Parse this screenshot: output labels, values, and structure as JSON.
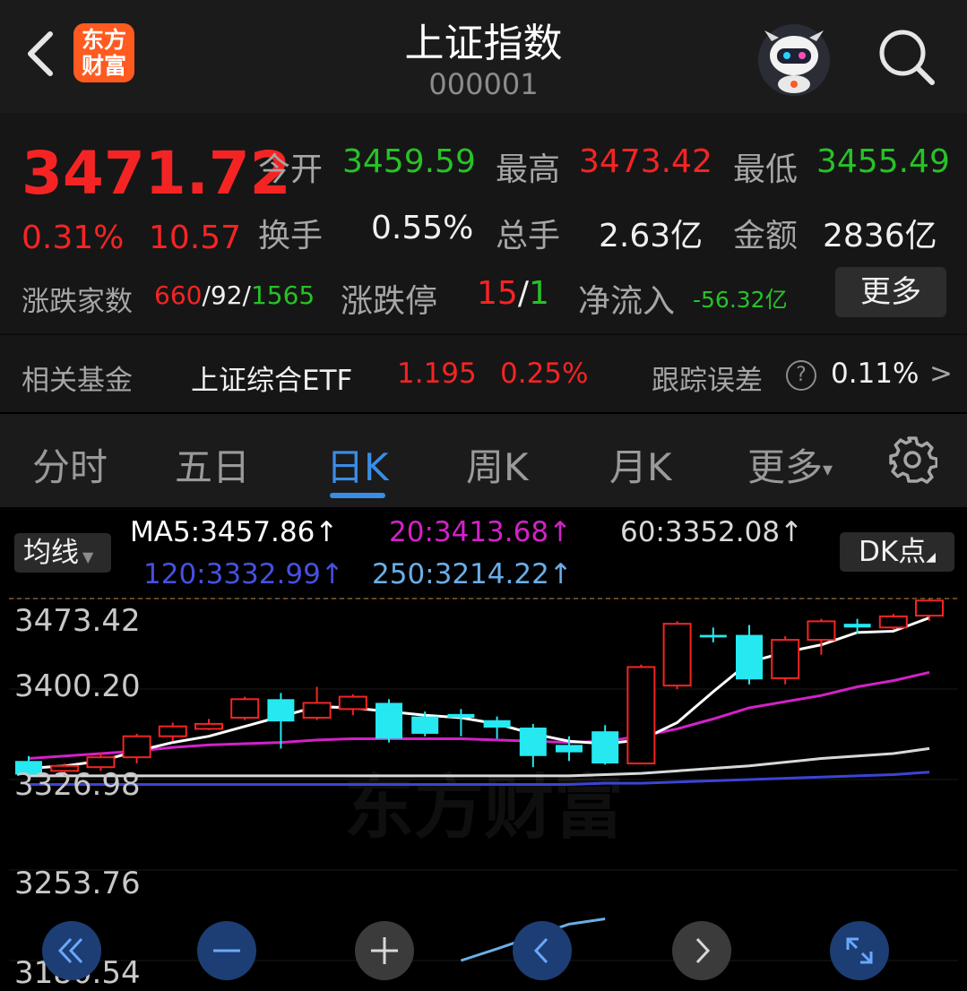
{
  "header": {
    "title": "上证指数",
    "code": "000001",
    "logo_line1": "东方",
    "logo_line2": "财富"
  },
  "quote": {
    "price": "3471.72",
    "change_pct": "0.31%",
    "change": "10.57",
    "open_label": "今开",
    "open": "3459.59",
    "high_label": "最高",
    "high": "3473.42",
    "low_label": "最低",
    "low": "3455.49",
    "turnover_label": "换手",
    "turnover": "0.55%",
    "volume_label": "总手",
    "volume": "2.63亿",
    "amount_label": "金额",
    "amount": "2836亿",
    "breadth_label": "涨跌家数",
    "breadth_up": "660",
    "breadth_flat": "92",
    "breadth_down": "1565",
    "sep": "/",
    "limit_label": "涨跌停",
    "limit_up": "15",
    "limit_down": "1",
    "netflow_label": "净流入",
    "netflow": "-56.32亿",
    "more": "更多"
  },
  "fund": {
    "label": "相关基金",
    "name": "上证综合ETF",
    "price": "1.195",
    "pct": "0.25%",
    "error_label": "跟踪误差",
    "error_value": "0.11%",
    "arrow": ">"
  },
  "tabs": [
    {
      "label": "分时"
    },
    {
      "label": "五日"
    },
    {
      "label": "日K"
    },
    {
      "label": "周K"
    },
    {
      "label": "月K"
    },
    {
      "label": "更多"
    }
  ],
  "indicator": {
    "selector": "均线",
    "dk": "DK点",
    "ma5": "MA5:3457.86↑",
    "ma20": "20:3413.68↑",
    "ma60": "60:3352.08↑",
    "ma120": "120:3332.99↑",
    "ma250": "250:3214.22↑"
  },
  "colors": {
    "up": "#f52424",
    "down": "#25e8f0",
    "ma5": "#ffffff",
    "ma20": "#d321c8",
    "ma60": "#d8d8d8",
    "ma120": "#3b44d6",
    "ma250": "#6aaee8"
  },
  "chart_data": {
    "type": "candlestick",
    "y_ticks": [
      "3473.42",
      "3400.20",
      "3326.98",
      "3253.76",
      "3180.54"
    ],
    "ylim": [
      3180.54,
      3473.42
    ],
    "watermark": "东方财富",
    "candles": [
      {
        "o": 3342,
        "c": 3331,
        "h": 3346,
        "l": 3329
      },
      {
        "o": 3334,
        "c": 3338,
        "h": 3340,
        "l": 3330
      },
      {
        "o": 3337,
        "c": 3345,
        "h": 3349,
        "l": 3334
      },
      {
        "o": 3345,
        "c": 3362,
        "h": 3364,
        "l": 3340
      },
      {
        "o": 3362,
        "c": 3370,
        "h": 3373,
        "l": 3358
      },
      {
        "o": 3368,
        "c": 3372,
        "h": 3376,
        "l": 3367
      },
      {
        "o": 3377,
        "c": 3392,
        "h": 3394,
        "l": 3375
      },
      {
        "o": 3392,
        "c": 3374,
        "h": 3397,
        "l": 3352
      },
      {
        "o": 3377,
        "c": 3389,
        "h": 3402,
        "l": 3375
      },
      {
        "o": 3384,
        "c": 3394,
        "h": 3396,
        "l": 3379
      },
      {
        "o": 3389,
        "c": 3360,
        "h": 3392,
        "l": 3357
      },
      {
        "o": 3378,
        "c": 3364,
        "h": 3382,
        "l": 3362
      },
      {
        "o": 3380,
        "c": 3377,
        "h": 3384,
        "l": 3362
      },
      {
        "o": 3375,
        "c": 3369,
        "h": 3378,
        "l": 3360
      },
      {
        "o": 3369,
        "c": 3346,
        "h": 3372,
        "l": 3337
      },
      {
        "o": 3355,
        "c": 3349,
        "h": 3362,
        "l": 3342
      },
      {
        "o": 3366,
        "c": 3340,
        "h": 3371,
        "l": 3339
      },
      {
        "o": 3340,
        "c": 3418,
        "h": 3420,
        "l": 3340
      },
      {
        "o": 3403,
        "c": 3453,
        "h": 3455,
        "l": 3400
      },
      {
        "o": 3444,
        "c": 3442,
        "h": 3450,
        "l": 3438
      },
      {
        "o": 3444,
        "c": 3408,
        "h": 3452,
        "l": 3404
      },
      {
        "o": 3409,
        "c": 3440,
        "h": 3443,
        "l": 3404
      },
      {
        "o": 3440,
        "c": 3455,
        "h": 3457,
        "l": 3428
      },
      {
        "o": 3453,
        "c": 3450,
        "h": 3457,
        "l": 3445
      },
      {
        "o": 3450,
        "c": 3459,
        "h": 3461,
        "l": 3448
      },
      {
        "o": 3459.59,
        "c": 3471.72,
        "h": 3473.42,
        "l": 3455.49
      }
    ],
    "ma5": [
      3336,
      3338,
      3342,
      3350,
      3357,
      3362,
      3370,
      3378,
      3386,
      3385,
      3382,
      3379,
      3377,
      3372,
      3364,
      3358,
      3356,
      3359,
      3373,
      3398,
      3422,
      3430,
      3436,
      3446,
      3447,
      3457.86
    ],
    "ma20": [
      3344,
      3346,
      3348,
      3350,
      3353,
      3355,
      3356,
      3357,
      3359,
      3360,
      3360,
      3360,
      3360,
      3359,
      3358,
      3357,
      3358,
      3362,
      3368,
      3376,
      3385,
      3390,
      3395,
      3402,
      3407,
      3413.68
    ],
    "ma60": [
      3330,
      3330,
      3330,
      3330,
      3330,
      3330,
      3330,
      3330,
      3330,
      3330,
      3330,
      3330,
      3330,
      3330,
      3330,
      3330,
      3331,
      3332,
      3334,
      3336,
      3338,
      3341,
      3344,
      3346,
      3348,
      3352.08
    ],
    "ma120": [
      3323,
      3323,
      3323,
      3323,
      3323,
      3323,
      3323,
      3323,
      3323,
      3323,
      3323,
      3323,
      3323,
      3323,
      3323,
      3323,
      3324,
      3324,
      3325,
      3326,
      3327,
      3328,
      3329,
      3330,
      3331,
      3332.99
    ],
    "ma250": [
      3180.54,
      3190,
      3200,
      3210,
      3214.22
    ]
  }
}
